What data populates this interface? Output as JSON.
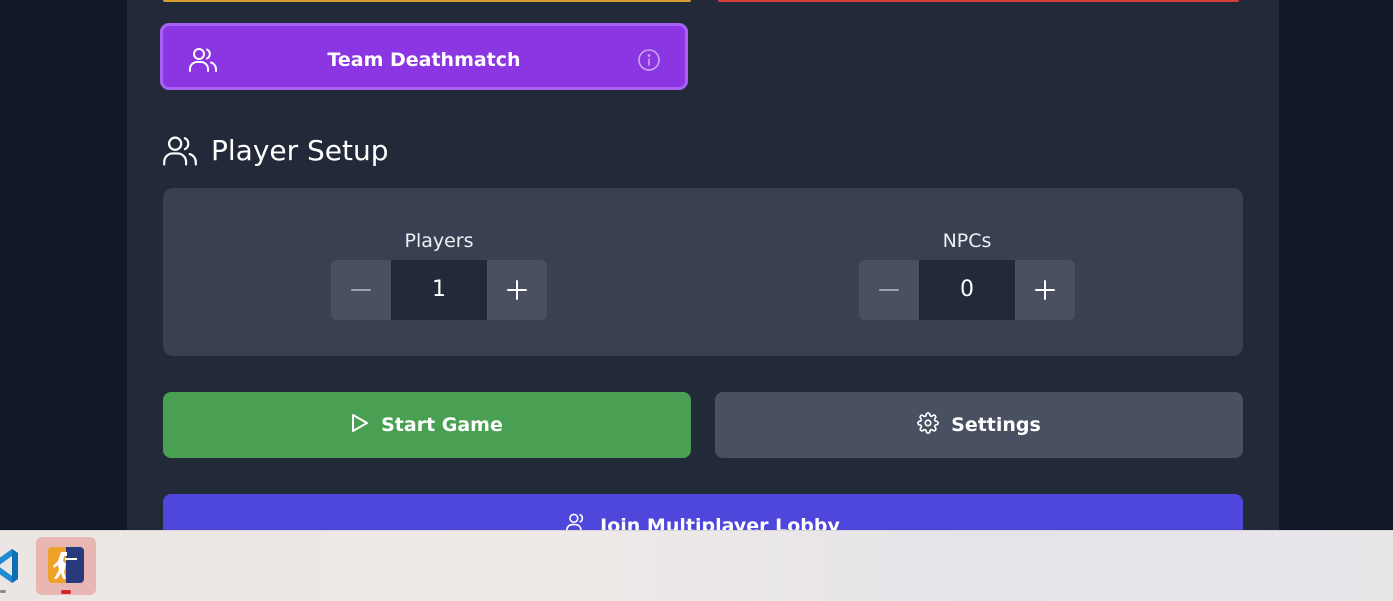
{
  "colors": {
    "background": "#111827",
    "panel": "#222a39",
    "mode_button": "#8b35e3",
    "start_button": "#4aa052",
    "settings_button": "#485061",
    "lobby_button": "#4f46dc",
    "top_left_strip": "#d69e2e",
    "top_right_strip": "#dc3b3b"
  },
  "game_mode": {
    "label": "Team Deathmatch",
    "icon": "users-icon",
    "info_icon": "info-icon"
  },
  "player_setup": {
    "title": "Player Setup",
    "icon": "users-icon",
    "players": {
      "label": "Players",
      "value": "1"
    },
    "npcs": {
      "label": "NPCs",
      "value": "0"
    }
  },
  "actions": {
    "start": {
      "label": "Start Game",
      "icon": "play-icon"
    },
    "settings": {
      "label": "Settings",
      "icon": "gear-icon"
    },
    "lobby": {
      "label": "Join Multiplayer Lobby",
      "icon": "users-icon"
    }
  },
  "taskbar": {
    "apps": [
      {
        "name": "vscode",
        "icon": "vscode-icon"
      },
      {
        "name": "game",
        "icon": "counter-strike-icon",
        "active": true
      }
    ]
  }
}
